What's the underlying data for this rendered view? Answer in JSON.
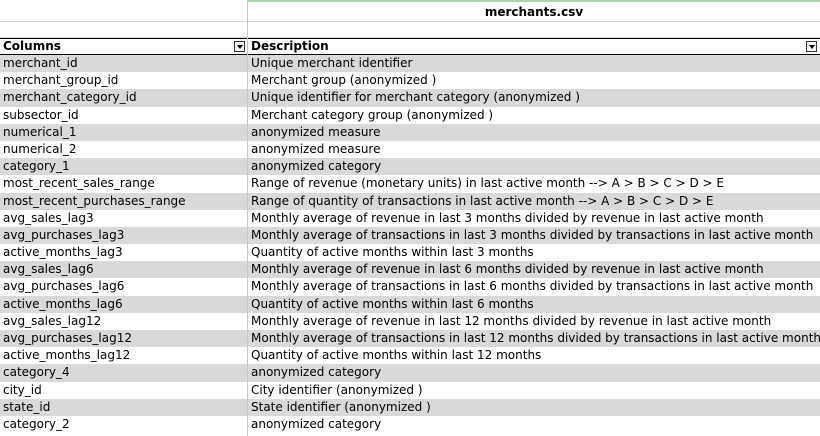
{
  "title": "merchants.csv",
  "headers": {
    "columns": "Columns",
    "description": "Description"
  },
  "rows": [
    {
      "column": "merchant_id",
      "description": "Unique merchant identifier"
    },
    {
      "column": "merchant_group_id",
      "description": "Merchant group (anonymized )"
    },
    {
      "column": "merchant_category_id",
      "description": "Unique identifier for merchant category (anonymized )"
    },
    {
      "column": "subsector_id",
      "description": "Merchant category group (anonymized )"
    },
    {
      "column": "numerical_1",
      "description": "anonymized measure"
    },
    {
      "column": "numerical_2",
      "description": "anonymized measure"
    },
    {
      "column": "category_1",
      "description": "anonymized category"
    },
    {
      "column": "most_recent_sales_range",
      "description": "Range of revenue (monetary units) in last active month --> A > B > C > D > E"
    },
    {
      "column": "most_recent_purchases_range",
      "description": "Range of quantity of transactions in last active month --> A > B > C > D > E"
    },
    {
      "column": "avg_sales_lag3",
      "description": "Monthly average of revenue in last 3 months divided by revenue in last active month"
    },
    {
      "column": "avg_purchases_lag3",
      "description": "Monthly average of transactions in last 3 months divided by transactions in last active month"
    },
    {
      "column": "active_months_lag3",
      "description": "Quantity of active months within last 3 months"
    },
    {
      "column": "avg_sales_lag6",
      "description": "Monthly average of revenue in last 6 months divided by revenue in last active month"
    },
    {
      "column": "avg_purchases_lag6",
      "description": "Monthly average of transactions in last 6 months divided by transactions in last active month"
    },
    {
      "column": "active_months_lag6",
      "description": "Quantity of active months within last 6 months"
    },
    {
      "column": "avg_sales_lag12",
      "description": "Monthly average of revenue in last 12 months divided by revenue in last active month"
    },
    {
      "column": "avg_purchases_lag12",
      "description": "Monthly average of transactions in last 12 months divided by transactions in last active month"
    },
    {
      "column": "active_months_lag12",
      "description": "Quantity of active months within last 12 months"
    },
    {
      "column": "category_4",
      "description": "anonymized category"
    },
    {
      "column": "city_id",
      "description": "City identifier (anonymized )"
    },
    {
      "column": "state_id",
      "description": "State identifier (anonymized )"
    },
    {
      "column": "category_2",
      "description": "anonymized category"
    }
  ],
  "colors": {
    "row_shade": "#d9d9d9",
    "title_border": "#a9d5b0"
  },
  "icons": {
    "filter": "filter-dropdown-icon"
  }
}
